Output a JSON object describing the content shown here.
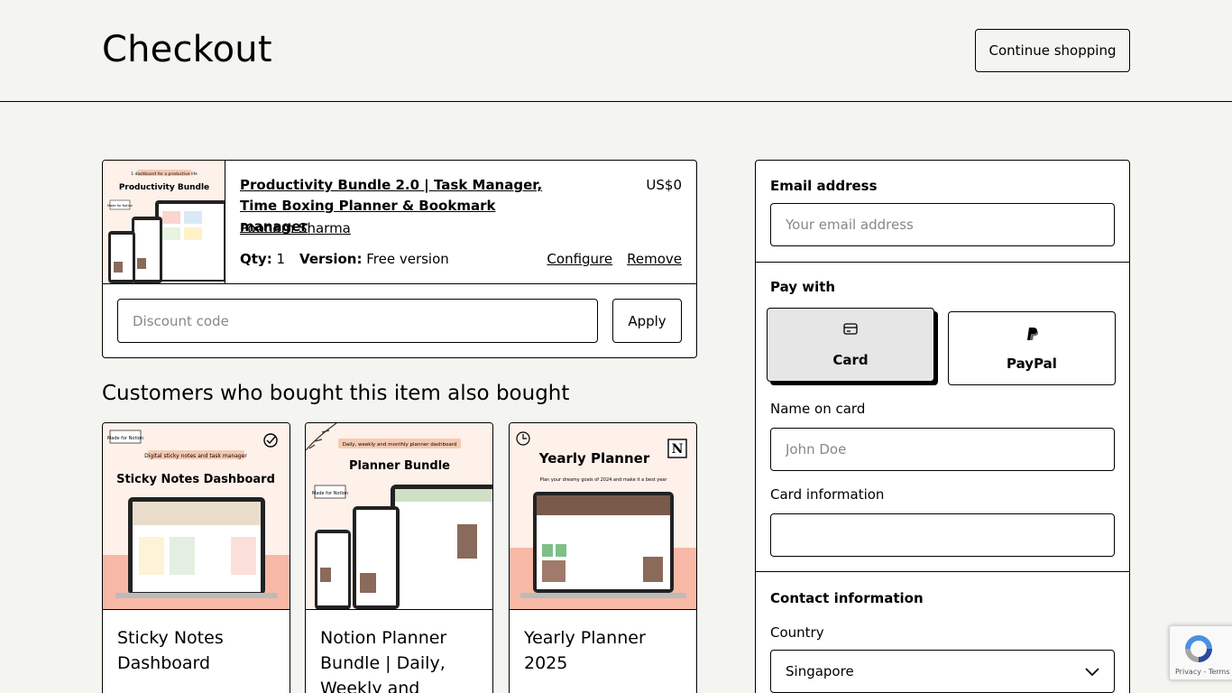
{
  "header": {
    "title": "Checkout",
    "continue_label": "Continue shopping"
  },
  "cart": {
    "item": {
      "title": "Productivity Bundle 2.0 | Task Manager, Time Boxing Planner & Bookmark manager",
      "seller": "Poonam Sharma",
      "price": "US$0",
      "qty_label": "Qty:",
      "qty": "1",
      "version_label": "Version:",
      "version": "Free version",
      "configure_label": "Configure",
      "remove_label": "Remove",
      "thumb_tagline": "1 dashboard for a productive life",
      "thumb_heading": "Productivity Bundle",
      "thumb_badge": "Made for Notion"
    },
    "discount_placeholder": "Discount code",
    "apply_label": "Apply"
  },
  "recommendations": {
    "heading": "Customers who bought this item also bought",
    "items": [
      {
        "title": "Sticky Notes Dashboard",
        "img_heading": "Sticky Notes Dashboard",
        "img_tagline": "Digital sticky notes and task manager",
        "img_badge": "Made for Notion"
      },
      {
        "title": "Notion Planner Bundle | Daily, Weekly and",
        "img_heading": "Planner Bundle",
        "img_tagline": "Daily, weekly and monthly planner dashboard",
        "img_badge": "Made for Notion"
      },
      {
        "title": "Yearly Planner 2025",
        "img_heading": "Yearly Planner",
        "img_tagline": "Plan your dreamy goals of 2024 and make it a best year",
        "img_badge": "N"
      }
    ]
  },
  "panel": {
    "email_label": "Email address",
    "email_placeholder": "Your email address",
    "pay_with_label": "Pay with",
    "card_label": "Card",
    "paypal_label": "PayPal",
    "name_label": "Name on card",
    "name_placeholder": "John Doe",
    "card_info_label": "Card information",
    "contact_label": "Contact information",
    "country_label": "Country",
    "country_value": "Singapore"
  },
  "recaptcha": {
    "links": "Privacy - Terms"
  },
  "colors": {
    "background": "#f4f4f0",
    "card_selected": "#e6e6e6",
    "thumb_peach": "#fbe9df",
    "thumb_salmon": "#f7b9a6"
  }
}
